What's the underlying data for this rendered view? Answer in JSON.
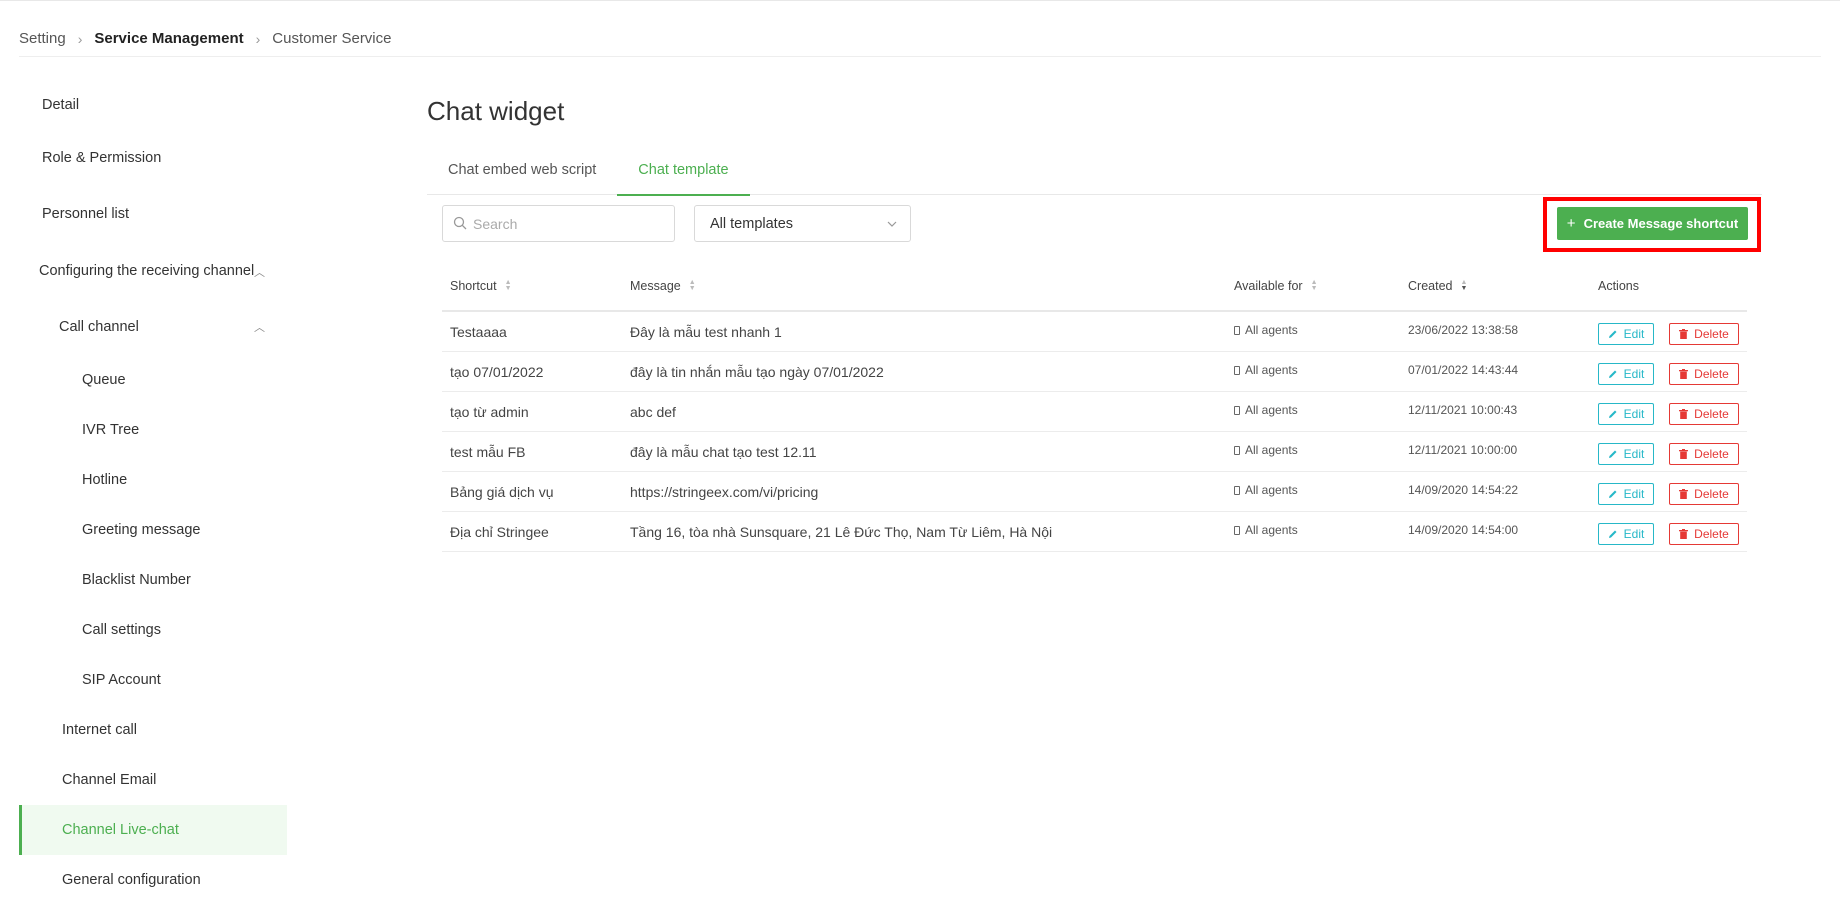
{
  "breadcrumb": {
    "items": [
      "Setting",
      "Service Management",
      "Customer Service"
    ]
  },
  "sidebar": {
    "items": [
      {
        "label": "Detail"
      },
      {
        "label": "Role & Permission"
      },
      {
        "label": "Personnel list"
      },
      {
        "label": "Configuring the receiving channel"
      },
      {
        "label": "Call channel"
      },
      {
        "label": "Queue"
      },
      {
        "label": "IVR Tree"
      },
      {
        "label": "Hotline"
      },
      {
        "label": "Greeting message"
      },
      {
        "label": "Blacklist Number"
      },
      {
        "label": "Call settings"
      },
      {
        "label": "SIP Account"
      },
      {
        "label": "Internet call"
      },
      {
        "label": "Channel Email"
      },
      {
        "label": "Channel Live-chat"
      },
      {
        "label": "General configuration"
      }
    ]
  },
  "main": {
    "title": "Chat widget",
    "tabs": [
      {
        "label": "Chat embed web script"
      },
      {
        "label": "Chat template"
      }
    ]
  },
  "toolbar": {
    "search_placeholder": "Search",
    "select_value": "All templates",
    "create_label": "Create Message shortcut"
  },
  "table": {
    "headers": {
      "shortcut": "Shortcut",
      "message": "Message",
      "available": "Available for",
      "created": "Created",
      "actions": "Actions"
    },
    "edit_label": "Edit",
    "delete_label": "Delete",
    "rows": [
      {
        "shortcut": "Testaaaa",
        "message": "Đây là mẫu test nhanh 1",
        "available": "All agents",
        "created": "23/06/2022 13:38:58"
      },
      {
        "shortcut": "tạo 07/01/2022",
        "message": "đây là tin nhắn mẫu tạo ngày 07/01/2022",
        "available": "All agents",
        "created": "07/01/2022 14:43:44"
      },
      {
        "shortcut": "tạo từ admin",
        "message": "abc def",
        "available": "All agents",
        "created": "12/11/2021 10:00:43"
      },
      {
        "shortcut": "test mẫu FB",
        "message": "đây là mẫu chat tạo test 12.11",
        "available": "All agents",
        "created": "12/11/2021 10:00:00"
      },
      {
        "shortcut": "Bảng giá dịch vụ",
        "message": "https://stringeex.com/vi/pricing",
        "available": "All agents",
        "created": "14/09/2020 14:54:22"
      },
      {
        "shortcut": "Địa chỉ Stringee",
        "message": "Tầng 16, tòa nhà Sunsquare, 21 Lê Đức Thọ, Nam Từ Liêm, Hà Nội",
        "available": "All agents",
        "created": "14/09/2020 14:54:00"
      }
    ]
  },
  "colors": {
    "accent": "#4caf50",
    "edit": "#26b8c8",
    "delete": "#e53935",
    "highlight_frame": "#ff0000"
  }
}
